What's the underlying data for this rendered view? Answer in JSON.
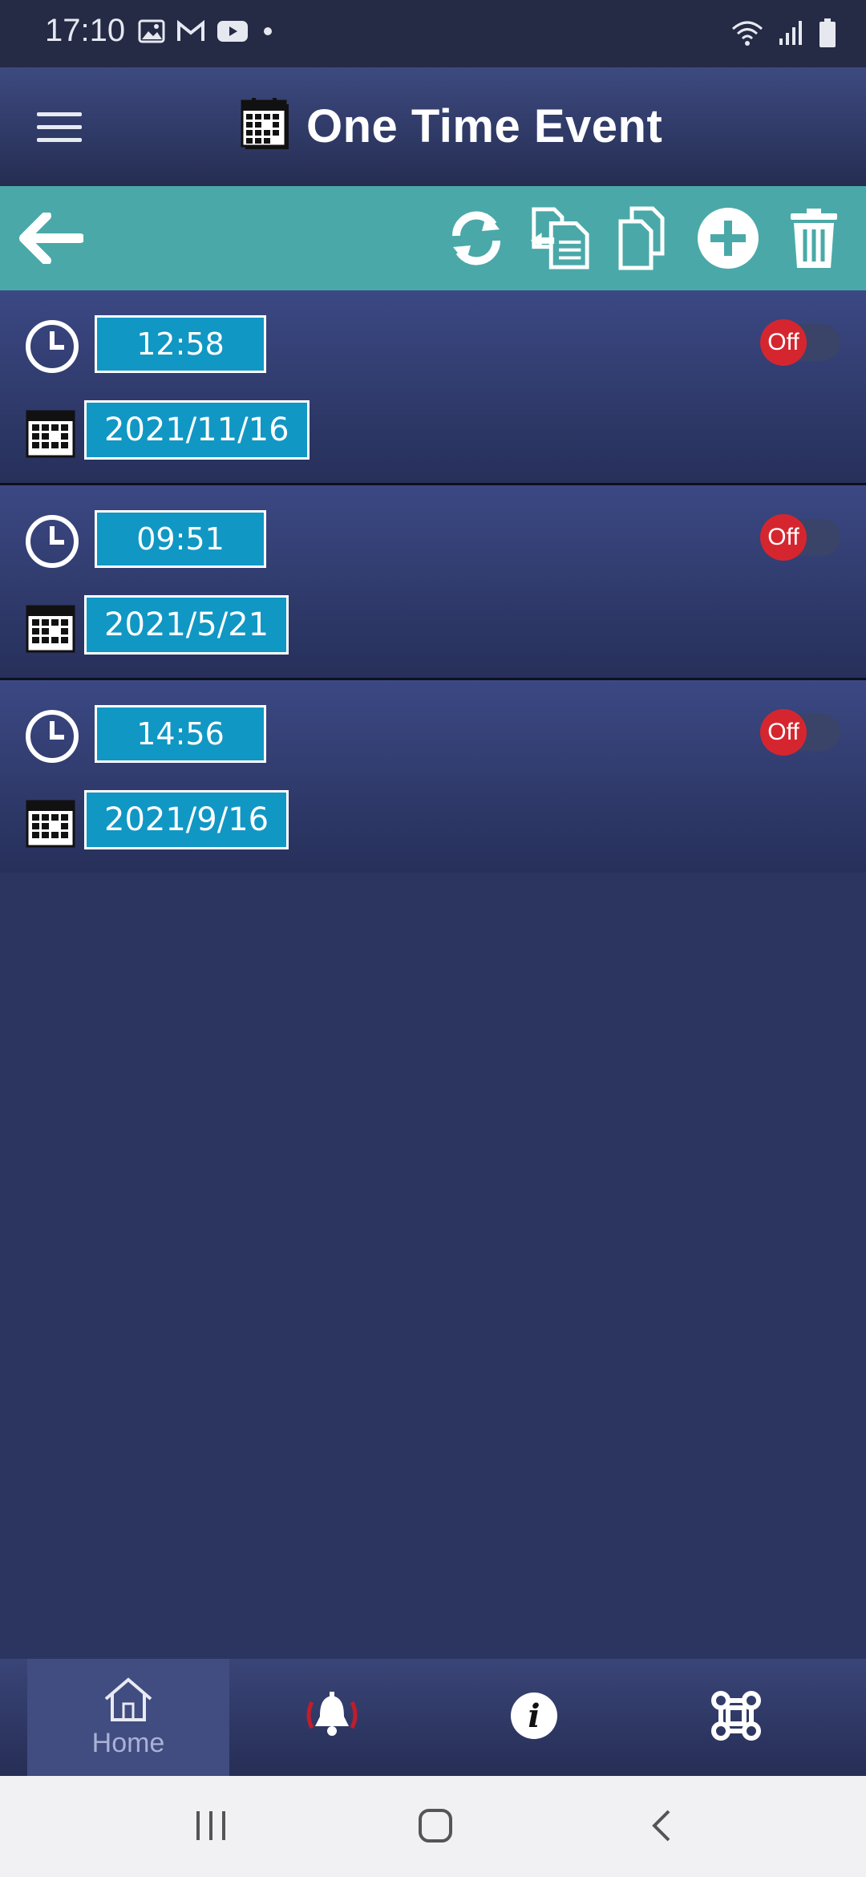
{
  "status_bar": {
    "time": "17:10",
    "left_icons": [
      "image-icon",
      "gmail-icon",
      "youtube-icon",
      "dot-icon"
    ],
    "right_icons": [
      "wifi-icon",
      "signal-icon",
      "battery-icon"
    ]
  },
  "app_bar": {
    "title": "One Time Event",
    "menu_icon": "hamburger-menu-icon",
    "title_icon": "calendar-icon"
  },
  "toolbar": {
    "buttons": [
      "back-arrow-icon",
      "refresh-icon",
      "import-icon",
      "copy-icon",
      "add-icon",
      "delete-icon"
    ]
  },
  "events": [
    {
      "time": "12:58",
      "date": "2021/11/16",
      "toggle": "Off"
    },
    {
      "time": "09:51",
      "date": "2021/5/21",
      "toggle": "Off"
    },
    {
      "time": "14:56",
      "date": "2021/9/16",
      "toggle": "Off"
    }
  ],
  "bottom_nav": {
    "items": [
      {
        "label": "Home",
        "icon": "home-icon",
        "active": true
      },
      {
        "label": "",
        "icon": "alarm-bell-icon"
      },
      {
        "label": "",
        "icon": "info-icon"
      },
      {
        "label": "",
        "icon": "command-icon"
      }
    ]
  },
  "colors": {
    "background": "#2c3560",
    "toolbar": "#4aa9a8",
    "field": "#1197c4",
    "toggle_off": "#d5262f"
  }
}
